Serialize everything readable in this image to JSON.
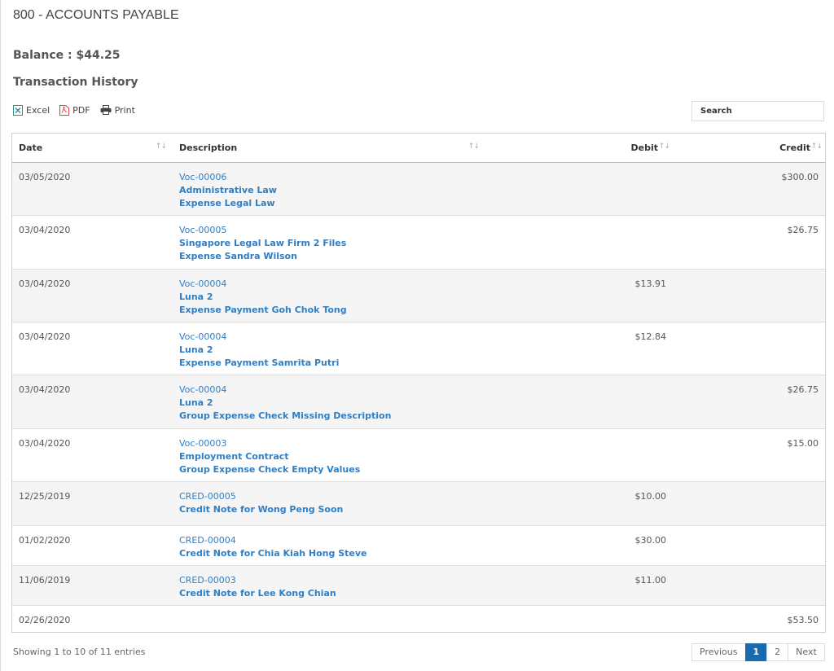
{
  "page": {
    "title": "800 - ACCOUNTS PAYABLE",
    "balance": "Balance : $44.25",
    "section_title": "Transaction History"
  },
  "toolbar": {
    "excel_label": "Excel",
    "pdf_label": "PDF",
    "print_label": "Print",
    "search_placeholder": "Search"
  },
  "table": {
    "columns": [
      "Date",
      "Description",
      "Debit",
      "Credit"
    ],
    "rows": [
      {
        "date": "03/05/2020",
        "lines": [
          "Voc-00006",
          "Administrative Law",
          "Expense Legal Law"
        ],
        "debit": "",
        "credit": "$300.00"
      },
      {
        "date": "03/04/2020",
        "lines": [
          "Voc-00005",
          "Singapore Legal Law Firm 2 Files",
          "Expense Sandra Wilson"
        ],
        "debit": "",
        "credit": "$26.75"
      },
      {
        "date": "03/04/2020",
        "lines": [
          "Voc-00004",
          "Luna 2",
          "Expense Payment Goh Chok Tong"
        ],
        "debit": "$13.91",
        "credit": ""
      },
      {
        "date": "03/04/2020",
        "lines": [
          "Voc-00004",
          "Luna 2",
          "Expense Payment Samrita Putri"
        ],
        "debit": "$12.84",
        "credit": ""
      },
      {
        "date": "03/04/2020",
        "lines": [
          "Voc-00004",
          "Luna 2",
          "Group Expense Check Missing Description"
        ],
        "debit": "",
        "credit": "$26.75"
      },
      {
        "date": "03/04/2020",
        "lines": [
          "Voc-00003",
          "Employment Contract",
          "Group Expense Check Empty Values"
        ],
        "debit": "",
        "credit": "$15.00"
      },
      {
        "date": "12/25/2019",
        "lines": [
          "CRED-00005",
          "Credit Note for Wong Peng Soon"
        ],
        "debit": "$10.00",
        "credit": ""
      },
      {
        "date": "01/02/2020",
        "lines": [
          "CRED-00004",
          "Credit Note for Chia Kiah Hong Steve"
        ],
        "debit": "$30.00",
        "credit": ""
      },
      {
        "date": "11/06/2019",
        "lines": [
          "CRED-00003",
          "Credit Note for Lee Kong Chian"
        ],
        "debit": "$11.00",
        "credit": ""
      },
      {
        "date": "02/26/2020",
        "lines": [],
        "debit": "",
        "credit": "$53.50"
      }
    ]
  },
  "footer": {
    "info": "Showing 1 to 10 of 11 entries",
    "previous_label": "Previous",
    "next_label": "Next",
    "pages": [
      "1",
      "2"
    ],
    "active_page": "1"
  },
  "colors": {
    "link": "#2f7fc6",
    "active_page": "#1a6ab0",
    "excel_icon": "#2e8b8b",
    "pdf_icon": "#e04040"
  }
}
